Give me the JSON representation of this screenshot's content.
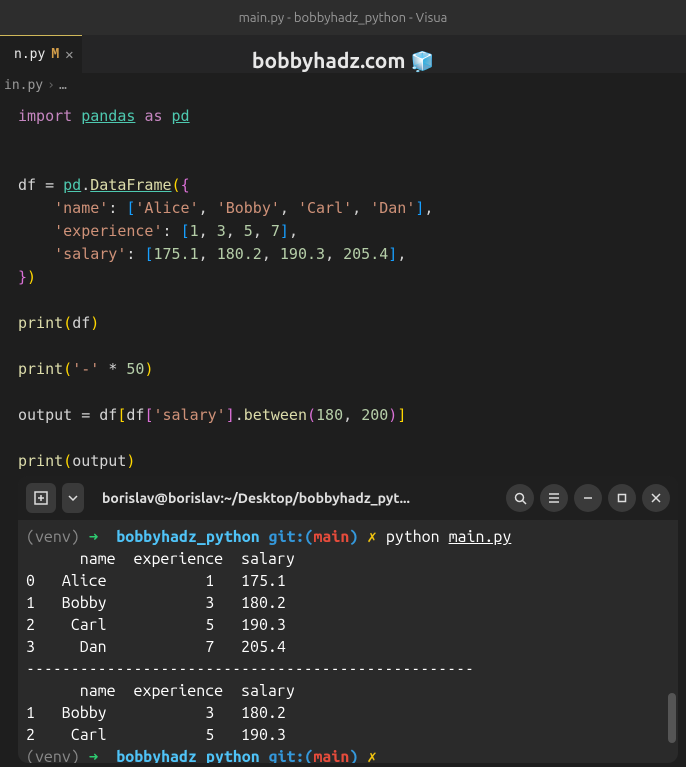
{
  "titlebar": "main.py - bobbyhadz_python - Visua",
  "tab": {
    "label": "n.py",
    "modified": "M"
  },
  "watermark": {
    "text": "bobbyhadz.com",
    "cube": "🧊"
  },
  "breadcrumb": {
    "file": "in.py",
    "sep": "›",
    "more": "…"
  },
  "code": {
    "l1": {
      "kw_import": "import",
      "mod": "pandas",
      "kw_as": "as",
      "alias": "pd"
    },
    "l2": {
      "var": "df",
      "eq": "=",
      "obj": "pd",
      "dot": ".",
      "fn": "DataFrame",
      "open": "({"
    },
    "l3": {
      "key": "'name'",
      "colon": ":",
      "open": "[",
      "v1": "'Alice'",
      "v2": "'Bobby'",
      "v3": "'Carl'",
      "v4": "'Dan'",
      "close": "],"
    },
    "l4": {
      "key": "'experience'",
      "colon": ":",
      "open": "[",
      "v1": "1",
      "v2": "3",
      "v3": "5",
      "v4": "7",
      "close": "],"
    },
    "l5": {
      "key": "'salary'",
      "colon": ":",
      "open": "[",
      "v1": "175.1",
      "v2": "180.2",
      "v3": "190.3",
      "v4": "205.4",
      "close": "],"
    },
    "l6": {
      "close": "})"
    },
    "l7": {
      "fn": "print",
      "arg": "df"
    },
    "l8": {
      "fn": "print",
      "str": "'-'",
      "op": "*",
      "num": "50"
    },
    "l9": {
      "var": "output",
      "eq": "=",
      "df": "df",
      "open": "[",
      "df2": "df",
      "open2": "[",
      "key": "'salary'",
      "close2": "]",
      "dot": ".",
      "fn": "between",
      "open3": "(",
      "a1": "180",
      "a2": "200",
      "close3": ")",
      "close": "]"
    },
    "l10": {
      "fn": "print",
      "arg": "output"
    }
  },
  "terminal": {
    "title": "borislav@borislav:~/Desktop/bobbyhadz_pyt...",
    "prompt": {
      "venv": "(venv)",
      "arrow": "➜",
      "dir": "bobbyhadz_python",
      "git": "git:(",
      "branch": "main",
      "git_close": ")",
      "dirty": "✗",
      "cmd": "python",
      "file": "main.py"
    },
    "output": {
      "header": "      name  experience  salary",
      "r0": "0   Alice           1   175.1",
      "r1": "1   Bobby           3   180.2",
      "r2": "2    Carl           5   190.3",
      "r3": "3     Dan           7   205.4",
      "sep": "--------------------------------------------------",
      "header2": "      name  experience  salary",
      "f1": "1   Bobby           3   180.2",
      "f2": "2    Carl           5   190.3"
    }
  }
}
